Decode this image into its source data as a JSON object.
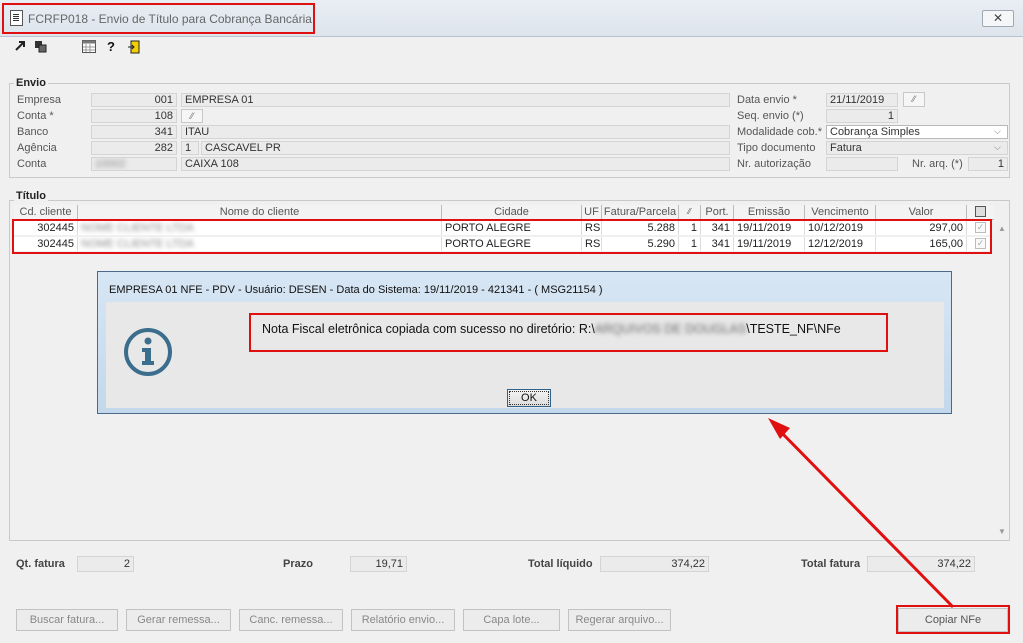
{
  "window": {
    "title": "FCRFP018 - Envio de Título para Cobrança Bancária",
    "close_glyph": "✕"
  },
  "toolbar": {
    "icons": [
      "forward-icon",
      "copy-icon",
      "calendar-icon",
      "help-icon",
      "exit-icon"
    ]
  },
  "envio": {
    "group_label": "Envio",
    "empresa": {
      "label": "Empresa",
      "code": "001",
      "name": "EMPRESA 01"
    },
    "conta_req": {
      "label": "Conta *",
      "code": "108"
    },
    "banco": {
      "label": "Banco",
      "code": "341",
      "name": "ITAU"
    },
    "agencia": {
      "label": "Agência",
      "code": "282",
      "digit": "1",
      "city": "CASCAVEL PR"
    },
    "conta": {
      "label": "Conta",
      "code": "10002",
      "name": "CAIXA 108"
    },
    "data_envio": {
      "label": "Data envio *",
      "value": "21/11/2019"
    },
    "seq_envio": {
      "label": "Seq. envio (*)",
      "value": "1"
    },
    "modalidade": {
      "label": "Modalidade cob.*",
      "value": "Cobrança Simples"
    },
    "tipo_documento": {
      "label": "Tipo documento",
      "value": "Fatura"
    },
    "nr_autorizacao": {
      "label": "Nr. autorização",
      "value": ""
    },
    "nr_arq": {
      "label": "Nr. arq. (*)",
      "value": "1"
    }
  },
  "titulo": {
    "group_label": "Título",
    "columns": [
      "Cd. cliente",
      "Nome do cliente",
      "Cidade",
      "UF",
      "Fatura/Parcela",
      "",
      "Port.",
      "Emissão",
      "Vencimento",
      "Valor"
    ],
    "rows": [
      {
        "cd_cliente": "302445",
        "nome": "NOME CLIENTE LTDA",
        "cidade": "PORTO ALEGRE",
        "uf": "RS",
        "fatura": "5.288",
        "parcela": "1",
        "port": "341",
        "emissao": "19/11/2019",
        "vencimento": "10/12/2019",
        "valor": "297,00",
        "checked": "✓"
      },
      {
        "cd_cliente": "302445",
        "nome": "NOME CLIENTE LTDA",
        "cidade": "PORTO ALEGRE",
        "uf": "RS",
        "fatura": "5.290",
        "parcela": "1",
        "port": "341",
        "emissao": "19/11/2019",
        "vencimento": "12/12/2019",
        "valor": "165,00",
        "checked": "✓"
      }
    ]
  },
  "footer": {
    "qt_fatura": {
      "label": "Qt. fatura",
      "value": "2"
    },
    "prazo": {
      "label": "Prazo",
      "value": "19,71"
    },
    "total_liquido": {
      "label": "Total líquido",
      "value": "374,22"
    },
    "total_fatura": {
      "label": "Total fatura",
      "value": "374,22"
    }
  },
  "buttons": {
    "buscar": "Buscar fatura...",
    "gerar": "Gerar remessa...",
    "canc": "Canc. remessa...",
    "relatorio": "Relatório envio...",
    "capa": "Capa lote...",
    "regerar": "Regerar arquivo...",
    "copiar": "Copiar NFe"
  },
  "dialog": {
    "title": "EMPRESA 01 NFE - PDV - Usuário: DESEN - Data do Sistema: 19/11/2019 - 421341 - ( MSG21154 )",
    "message_prefix": "Nota Fiscal eletrônica copiada com sucesso no diretório: R:\\",
    "message_hidden": "ARQUIVOS DE DOUGLAS",
    "message_suffix": "\\TESTE_NF\\NFe",
    "ok_label": "OK"
  },
  "colors": {
    "highlight": "#e01010",
    "dialog_border": "#4a6a8c",
    "info_icon": "#3b6d8c"
  }
}
